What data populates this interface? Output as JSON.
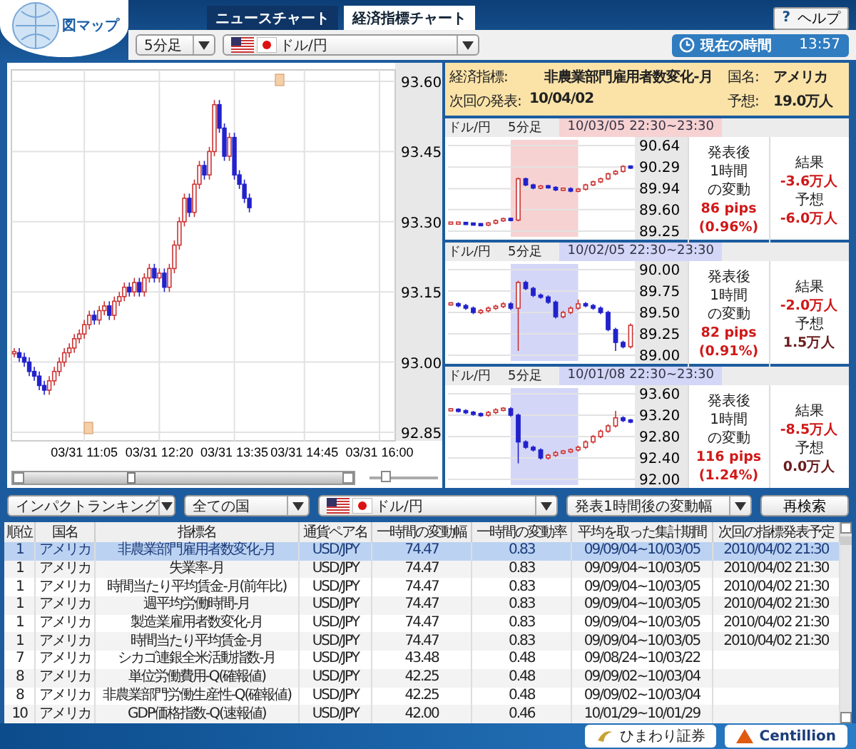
{
  "logo": {
    "text": "図マップ"
  },
  "tabs": [
    {
      "label": "ニュースチャート",
      "selected": false
    },
    {
      "label": "経済指標チャート",
      "selected": true
    }
  ],
  "help": {
    "icon": "?",
    "label": "ヘルプ"
  },
  "interval_select": {
    "value": "5分足"
  },
  "pair_select": {
    "value": "ドル/円"
  },
  "clock": {
    "label": "現在の時間",
    "time": "13:57"
  },
  "main_chart": {
    "chart_data": {
      "type": "candlestick",
      "grid": true,
      "ylim": [
        92.85,
        93.6
      ],
      "yticks": [
        {
          "value": 93.6,
          "label": "93.60"
        },
        {
          "value": 93.45,
          "label": "93.45"
        },
        {
          "value": 93.3,
          "label": "93.30"
        },
        {
          "value": 93.15,
          "label": "93.15"
        },
        {
          "value": 93.0,
          "label": "93.00"
        },
        {
          "value": 92.85,
          "label": "92.85"
        }
      ],
      "categories": [
        null,
        null,
        null,
        null,
        null,
        null,
        null,
        null,
        null,
        null,
        null,
        null,
        null,
        null,
        "03/31 11:05",
        null,
        null,
        null,
        null,
        null,
        null,
        null,
        null,
        null,
        null,
        null,
        null,
        null,
        null,
        "03/31 12:20",
        null,
        null,
        null,
        null,
        null,
        null,
        null,
        null,
        null,
        null,
        null,
        null,
        null,
        null,
        "03/31 13:35",
        null,
        null,
        null,
        null,
        null,
        null,
        null,
        null,
        null,
        null,
        null,
        null,
        null,
        "03/31 14:45",
        null,
        null,
        null,
        null,
        null,
        null,
        null,
        null,
        null,
        null,
        null,
        null,
        null,
        null,
        "03/31 16:00",
        null,
        null
      ],
      "ohlc": [
        [
          93.02,
          93.03,
          93.01,
          93.02
        ],
        [
          93.02,
          93.03,
          93.0,
          93.01
        ],
        [
          93.01,
          93.02,
          92.99,
          93.0
        ],
        [
          93.0,
          93.01,
          92.97,
          92.98
        ],
        [
          92.98,
          92.99,
          92.96,
          92.97
        ],
        [
          92.97,
          92.98,
          92.94,
          92.95
        ],
        [
          92.95,
          92.96,
          92.93,
          92.94
        ],
        [
          92.94,
          92.97,
          92.93,
          92.96
        ],
        [
          92.96,
          92.99,
          92.95,
          92.98
        ],
        [
          92.98,
          93.01,
          92.97,
          93.0
        ],
        [
          93.0,
          93.03,
          92.99,
          93.02
        ],
        [
          93.02,
          93.04,
          93.01,
          93.03
        ],
        [
          93.03,
          93.06,
          93.02,
          93.05
        ],
        [
          93.05,
          93.07,
          93.04,
          93.06
        ],
        [
          93.06,
          93.09,
          93.05,
          93.08
        ],
        [
          93.08,
          93.11,
          93.07,
          93.1
        ],
        [
          93.1,
          93.11,
          93.08,
          93.09
        ],
        [
          93.09,
          93.12,
          93.08,
          93.11
        ],
        [
          93.11,
          93.13,
          93.1,
          93.12
        ],
        [
          93.12,
          93.13,
          93.09,
          93.1
        ],
        [
          93.1,
          93.14,
          93.09,
          93.13
        ],
        [
          93.13,
          93.15,
          93.12,
          93.14
        ],
        [
          93.14,
          93.17,
          93.13,
          93.16
        ],
        [
          93.16,
          93.17,
          93.14,
          93.15
        ],
        [
          93.15,
          93.18,
          93.14,
          93.17
        ],
        [
          93.17,
          93.18,
          93.14,
          93.15
        ],
        [
          93.15,
          93.19,
          93.14,
          93.18
        ],
        [
          93.18,
          93.21,
          93.17,
          93.2
        ],
        [
          93.2,
          93.21,
          93.17,
          93.18
        ],
        [
          93.18,
          93.2,
          93.17,
          93.19
        ],
        [
          93.19,
          93.2,
          93.15,
          93.16
        ],
        [
          93.16,
          93.21,
          93.15,
          93.2
        ],
        [
          93.2,
          93.26,
          93.19,
          93.25
        ],
        [
          93.25,
          93.31,
          93.24,
          93.3
        ],
        [
          93.3,
          93.36,
          93.29,
          93.35
        ],
        [
          93.35,
          93.36,
          93.31,
          93.32
        ],
        [
          93.32,
          93.39,
          93.31,
          93.38
        ],
        [
          93.38,
          93.43,
          93.37,
          93.42
        ],
        [
          93.42,
          93.43,
          93.39,
          93.4
        ],
        [
          93.4,
          93.46,
          93.39,
          93.45
        ],
        [
          93.45,
          93.56,
          93.44,
          93.55
        ],
        [
          93.55,
          93.56,
          93.49,
          93.5
        ],
        [
          93.5,
          93.51,
          93.43,
          93.44
        ],
        [
          93.44,
          93.49,
          93.43,
          93.48
        ],
        [
          93.48,
          93.49,
          93.39,
          93.4
        ],
        [
          93.4,
          93.41,
          93.37,
          93.38
        ],
        [
          93.38,
          93.39,
          93.34,
          93.35
        ],
        [
          93.35,
          93.36,
          93.32,
          93.33
        ],
        null,
        null,
        null,
        null,
        null,
        null,
        null,
        null,
        null,
        null,
        null,
        null,
        null,
        null,
        null,
        null,
        null,
        null,
        null,
        null,
        null,
        null,
        null,
        null,
        null,
        null,
        null,
        null
      ]
    }
  },
  "zoom": {
    "level": 0.2
  },
  "indicator": {
    "fields": [
      {
        "label": "経済指標:",
        "value": "非農業部門雇用者数変化-月"
      },
      {
        "label": "国名:",
        "value": "アメリカ"
      },
      {
        "label": "次回の発表:",
        "value": "10/04/02"
      },
      {
        "label": "予想:",
        "value": "19.0万人"
      }
    ]
  },
  "history": [
    {
      "pair": "ドル/円",
      "interval": "5分足",
      "period": "10/03/05 22:30~23:30",
      "color": "#f7d2d2",
      "stat_lines": [
        "発表後",
        "1時間",
        "の変動"
      ],
      "pips": "86 pips",
      "percent": "(0.96%)",
      "result_label": "結果",
      "result": "-3.6万人",
      "forecast_label": "予想",
      "forecast": "-6.0万人",
      "forecast_highlighted": true,
      "chart_data": {
        "type": "candlestick",
        "grid": true,
        "ylim": [
          89.25,
          90.64
        ],
        "yticks": [
          {
            "value": 90.64,
            "label": "90.64"
          },
          {
            "value": 90.29,
            "label": "90.29"
          },
          {
            "value": 89.94,
            "label": "89.94"
          },
          {
            "value": 89.6,
            "label": "89.60"
          },
          {
            "value": 89.25,
            "label": "89.25"
          }
        ],
        "ohlc": [
          [
            89.38,
            89.4,
            89.36,
            89.38
          ],
          [
            89.38,
            89.4,
            89.36,
            89.38
          ],
          [
            89.38,
            89.4,
            89.35,
            89.37
          ],
          [
            89.37,
            89.39,
            89.34,
            89.36
          ],
          [
            89.36,
            89.38,
            89.33,
            89.35
          ],
          [
            89.35,
            89.4,
            89.33,
            89.38
          ],
          [
            89.38,
            89.44,
            89.36,
            89.42
          ],
          [
            89.42,
            89.47,
            89.4,
            89.45
          ],
          [
            89.45,
            89.47,
            89.41,
            89.43
          ],
          [
            89.43,
            90.12,
            89.41,
            90.1
          ],
          [
            90.1,
            90.12,
            89.98,
            90.0
          ],
          [
            90.0,
            90.02,
            89.93,
            89.95
          ],
          [
            89.95,
            90.0,
            89.93,
            89.98
          ],
          [
            89.98,
            90.0,
            89.94,
            89.96
          ],
          [
            89.96,
            89.98,
            89.9,
            89.92
          ],
          [
            89.92,
            89.96,
            89.9,
            89.94
          ],
          [
            89.94,
            89.96,
            89.88,
            89.9
          ],
          [
            89.9,
            89.95,
            89.88,
            89.93
          ],
          [
            89.93,
            90.02,
            89.91,
            90.0
          ],
          [
            90.0,
            90.07,
            89.98,
            90.05
          ],
          [
            90.05,
            90.12,
            90.03,
            90.1
          ],
          [
            90.1,
            90.2,
            90.08,
            90.18
          ],
          [
            90.18,
            90.24,
            90.16,
            90.22
          ],
          [
            90.22,
            90.32,
            90.2,
            90.3
          ],
          [
            90.3,
            90.32,
            90.26,
            90.28
          ]
        ]
      }
    },
    {
      "pair": "ドル/円",
      "interval": "5分足",
      "period": "10/02/05 22:30~23:30",
      "color": "#d4d6f7",
      "stat_lines": [
        "発表後",
        "1時間",
        "の変動"
      ],
      "pips": "82 pips",
      "percent": "(0.91%)",
      "result_label": "結果",
      "result": "-2.0万人",
      "forecast_label": "予想",
      "forecast": "1.5万人",
      "forecast_highlighted": false,
      "chart_data": {
        "type": "candlestick",
        "grid": true,
        "ylim": [
          89.0,
          90.0
        ],
        "yticks": [
          {
            "value": 90.0,
            "label": "90.00"
          },
          {
            "value": 89.75,
            "label": "89.75"
          },
          {
            "value": 89.5,
            "label": "89.50"
          },
          {
            "value": 89.25,
            "label": "89.25"
          },
          {
            "value": 89.0,
            "label": "89.00"
          }
        ],
        "ohlc": [
          [
            89.6,
            89.62,
            89.58,
            89.6
          ],
          [
            89.6,
            89.62,
            89.56,
            89.58
          ],
          [
            89.58,
            89.6,
            89.53,
            89.55
          ],
          [
            89.55,
            89.57,
            89.48,
            89.5
          ],
          [
            89.5,
            89.54,
            89.48,
            89.52
          ],
          [
            89.52,
            89.57,
            89.5,
            89.55
          ],
          [
            89.55,
            89.59,
            89.53,
            89.57
          ],
          [
            89.57,
            89.62,
            89.55,
            89.6
          ],
          [
            89.6,
            89.62,
            89.53,
            89.55
          ],
          [
            89.55,
            89.87,
            89.05,
            89.85
          ],
          [
            89.85,
            89.87,
            89.76,
            89.78
          ],
          [
            89.78,
            89.8,
            89.68,
            89.7
          ],
          [
            89.7,
            89.72,
            89.66,
            89.68
          ],
          [
            89.68,
            89.7,
            89.6,
            89.62
          ],
          [
            89.62,
            89.64,
            89.43,
            89.45
          ],
          [
            89.45,
            89.52,
            89.43,
            89.5
          ],
          [
            89.5,
            89.57,
            89.48,
            89.55
          ],
          [
            89.55,
            89.65,
            89.53,
            89.6
          ],
          [
            89.6,
            89.62,
            89.56,
            89.58
          ],
          [
            89.58,
            89.6,
            89.53,
            89.55
          ],
          [
            89.55,
            89.57,
            89.48,
            89.5
          ],
          [
            89.5,
            89.52,
            89.28,
            89.3
          ],
          [
            89.3,
            89.32,
            89.05,
            89.15
          ],
          [
            89.15,
            89.17,
            89.08,
            89.1
          ],
          [
            89.1,
            89.37,
            89.08,
            89.35
          ]
        ]
      }
    },
    {
      "pair": "ドル/円",
      "interval": "5分足",
      "period": "10/01/08 22:30~23:30",
      "color": "#d4d6f7",
      "stat_lines": [
        "発表後",
        "1時間",
        "の変動"
      ],
      "pips": "116 pips",
      "percent": "(1.24%)",
      "result_label": "結果",
      "result": "-8.5万人",
      "forecast_label": "予想",
      "forecast": "0.0万人",
      "forecast_highlighted": false,
      "chart_data": {
        "type": "candlestick",
        "grid": true,
        "ylim": [
          92.0,
          93.6
        ],
        "yticks": [
          {
            "value": 93.6,
            "label": "93.60"
          },
          {
            "value": 93.2,
            "label": "93.20"
          },
          {
            "value": 92.8,
            "label": "92.80"
          },
          {
            "value": 92.4,
            "label": "92.40"
          },
          {
            "value": 92.0,
            "label": "92.00"
          }
        ],
        "ohlc": [
          [
            93.3,
            93.33,
            93.27,
            93.3
          ],
          [
            93.3,
            93.33,
            93.25,
            93.28
          ],
          [
            93.28,
            93.31,
            93.22,
            93.25
          ],
          [
            93.25,
            93.28,
            93.19,
            93.22
          ],
          [
            93.22,
            93.25,
            93.17,
            93.2
          ],
          [
            93.2,
            93.28,
            93.17,
            93.25
          ],
          [
            93.25,
            93.33,
            93.22,
            93.3
          ],
          [
            93.3,
            93.35,
            93.27,
            93.32
          ],
          [
            93.32,
            93.35,
            93.17,
            93.2
          ],
          [
            93.2,
            93.23,
            92.3,
            92.7
          ],
          [
            92.7,
            92.73,
            92.57,
            92.6
          ],
          [
            92.6,
            92.63,
            92.52,
            92.55
          ],
          [
            92.55,
            92.58,
            92.37,
            92.4
          ],
          [
            92.4,
            92.48,
            92.37,
            92.45
          ],
          [
            92.45,
            92.53,
            92.42,
            92.5
          ],
          [
            92.5,
            92.55,
            92.47,
            92.52
          ],
          [
            92.52,
            92.58,
            92.49,
            92.55
          ],
          [
            92.55,
            92.63,
            92.52,
            92.6
          ],
          [
            92.6,
            92.73,
            92.57,
            92.7
          ],
          [
            92.7,
            92.83,
            92.67,
            92.8
          ],
          [
            92.8,
            92.93,
            92.77,
            92.9
          ],
          [
            92.9,
            93.03,
            92.87,
            93.0
          ],
          [
            93.0,
            93.28,
            92.97,
            93.15
          ],
          [
            93.15,
            93.18,
            93.07,
            93.1
          ],
          [
            93.1,
            93.13,
            93.05,
            93.08
          ]
        ]
      }
    }
  ],
  "filters": [
    {
      "value": "インパクトランキング",
      "flag": false
    },
    {
      "value": "全ての国",
      "flag": false
    },
    {
      "value": "ドル/円",
      "flag": true
    },
    {
      "value": "発表1時間後の変動幅",
      "flag": false
    }
  ],
  "search_button": "再検索",
  "table": {
    "columns": [
      "順位",
      "国名",
      "指標名",
      "通貨ペア名",
      "一時間の変動幅",
      "一時間の変動率",
      "平均を取った集計期間",
      "次回の指標発表予定"
    ],
    "rows": [
      {
        "selected": true,
        "cells": [
          "1",
          "アメリカ",
          "非農業部門雇用者数変化-月",
          "USD/JPY",
          "74.47",
          "0.83",
          "09/09/04~10/03/05",
          "2010/04/02 21:30"
        ]
      },
      {
        "selected": false,
        "cells": [
          "1",
          "アメリカ",
          "失業率-月",
          "USD/JPY",
          "74.47",
          "0.83",
          "09/09/04~10/03/05",
          "2010/04/02 21:30"
        ]
      },
      {
        "selected": false,
        "cells": [
          "1",
          "アメリカ",
          "時間当たり平均賃金-月(前年比)",
          "USD/JPY",
          "74.47",
          "0.83",
          "09/09/04~10/03/05",
          "2010/04/02 21:30"
        ]
      },
      {
        "selected": false,
        "cells": [
          "1",
          "アメリカ",
          "週平均労働時間-月",
          "USD/JPY",
          "74.47",
          "0.83",
          "09/09/04~10/03/05",
          "2010/04/02 21:30"
        ]
      },
      {
        "selected": false,
        "cells": [
          "1",
          "アメリカ",
          "製造業雇用者数変化-月",
          "USD/JPY",
          "74.47",
          "0.83",
          "09/09/04~10/03/05",
          "2010/04/02 21:30"
        ]
      },
      {
        "selected": false,
        "cells": [
          "1",
          "アメリカ",
          "時間当たり平均賃金-月",
          "USD/JPY",
          "74.47",
          "0.83",
          "09/09/04~10/03/05",
          "2010/04/02 21:30"
        ]
      },
      {
        "selected": false,
        "cells": [
          "7",
          "アメリカ",
          "シカゴ連銀全米活動指数-月",
          "USD/JPY",
          "43.48",
          "0.48",
          "09/08/24~10/03/22"
        ]
      },
      {
        "selected": false,
        "cells": [
          "8",
          "アメリカ",
          "単位労働費用-Q(確報値)",
          "USD/JPY",
          "42.25",
          "0.48",
          "09/09/02~10/03/04"
        ]
      },
      {
        "selected": false,
        "cells": [
          "8",
          "アメリカ",
          "非農業部門労働生産性-Q(確報値)",
          "USD/JPY",
          "42.25",
          "0.48",
          "09/09/02~10/03/04"
        ]
      },
      {
        "selected": false,
        "cells": [
          "10",
          "アメリカ",
          "GDP価格指数-Q(速報値)",
          "USD/JPY",
          "42.00",
          "0.46",
          "10/01/29~10/01/29"
        ]
      }
    ]
  },
  "sponsors": [
    {
      "kind": "himawari",
      "label": "ひまわり証券"
    },
    {
      "kind": "centillion",
      "label": "Centillion"
    }
  ]
}
